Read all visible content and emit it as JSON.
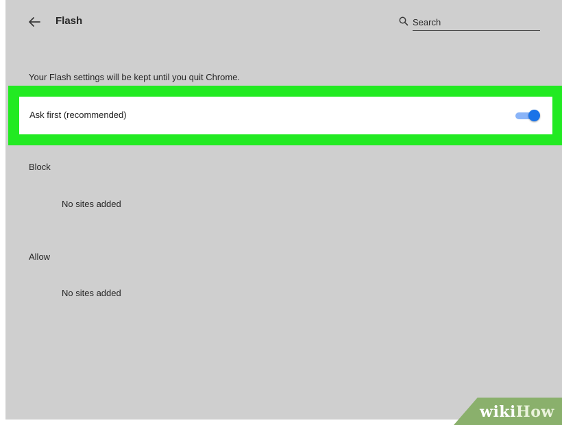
{
  "header": {
    "title": "Flash",
    "back_icon": "arrow-left-icon",
    "search": {
      "icon": "search-icon",
      "placeholder": "Search"
    }
  },
  "notice": "Your Flash settings will be kept until you quit Chrome.",
  "ask_first": {
    "label": "Ask first (recommended)",
    "enabled": true,
    "accent_color": "#1a73e8",
    "highlight_color": "#22ea22"
  },
  "sections": [
    {
      "label": "Block",
      "empty_text": "No sites added"
    },
    {
      "label": "Allow",
      "empty_text": "No sites added"
    }
  ],
  "watermark": {
    "part1": "wiki",
    "part2": "How"
  },
  "colors": {
    "panel_background": "#cfcfcf",
    "watermark_background": "#8ab06c"
  }
}
